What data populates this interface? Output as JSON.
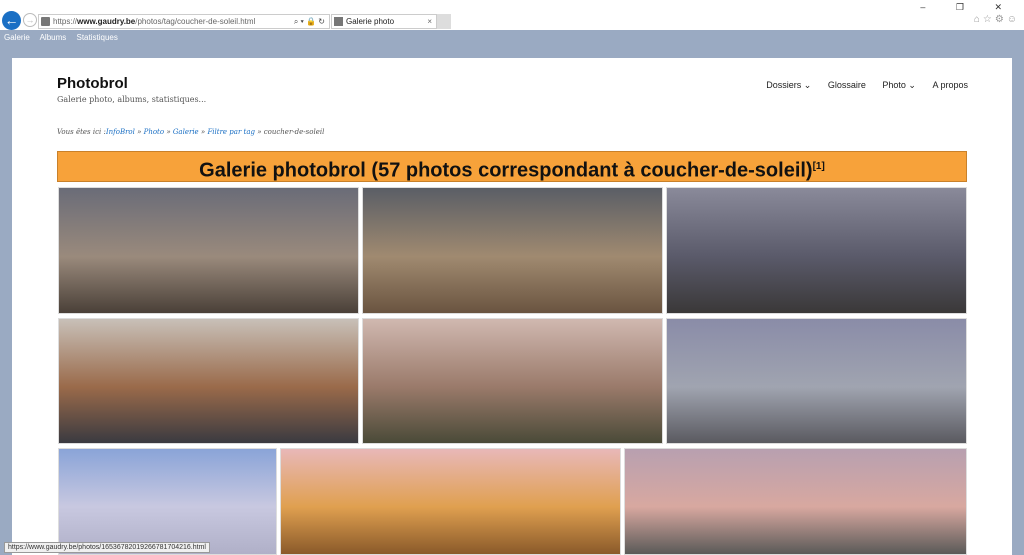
{
  "browser": {
    "url_scheme": "https://",
    "url_host": "www.gaudry.be",
    "url_path": "/photos/tag/coucher-de-soleil.html",
    "tab_title": "Galerie photo",
    "window_controls": "– ❐ ✕",
    "ie_icons": "⌂☆⚙☺"
  },
  "topnav": [
    "Galerie",
    "Albums",
    "Statistiques"
  ],
  "site": {
    "title": "Photobrol",
    "tagline": "Galerie photo, albums, statistiques..."
  },
  "menu": [
    "Dossiers ⌄",
    "Glossaire",
    "Photo ⌄",
    "A propos"
  ],
  "breadcrumb": {
    "prefix": "Vous êtes ici :",
    "links": [
      "InfoBrol",
      "Photo",
      "Galerie",
      "Filtre par tag"
    ],
    "sep": " » ",
    "current": "coucher-de-soleil"
  },
  "banner": {
    "title": "Galerie photobrol (57 photos correspondant à coucher-de-soleil)",
    "note": "[1]"
  },
  "status_url": "https://www.gaudry.be/photos/16536782019266781704216.html",
  "photos": [
    {
      "name": "cliffs-sea",
      "colors": [
        "#6a6c78",
        "#9a8a7c",
        "#4a4038"
      ]
    },
    {
      "name": "rock-closeup",
      "colors": [
        "#5a5e66",
        "#a08a70",
        "#6a5440"
      ]
    },
    {
      "name": "portovenere-church",
      "colors": [
        "#8a8a9a",
        "#5a5a6a",
        "#3a3838"
      ]
    },
    {
      "name": "manarola",
      "colors": [
        "#c8c0b8",
        "#9a6a4a",
        "#3a3a40"
      ]
    },
    {
      "name": "church-tower",
      "colors": [
        "#d0b8b0",
        "#9a7a6a",
        "#4a4a38"
      ]
    },
    {
      "name": "modern-building",
      "colors": [
        "#8a8ca8",
        "#a0a4b0",
        "#5a5a60"
      ]
    },
    {
      "name": "sky-tower",
      "colors": [
        "#8aa4d8",
        "#c8c8e0",
        "#b0b0c8"
      ]
    },
    {
      "name": "bottles-sunset",
      "colors": [
        "#e8b8b8",
        "#e0a050",
        "#8a5a2a"
      ]
    },
    {
      "name": "winter-field",
      "colors": [
        "#b8a0b0",
        "#d8a8a0",
        "#5a5a58"
      ]
    }
  ]
}
